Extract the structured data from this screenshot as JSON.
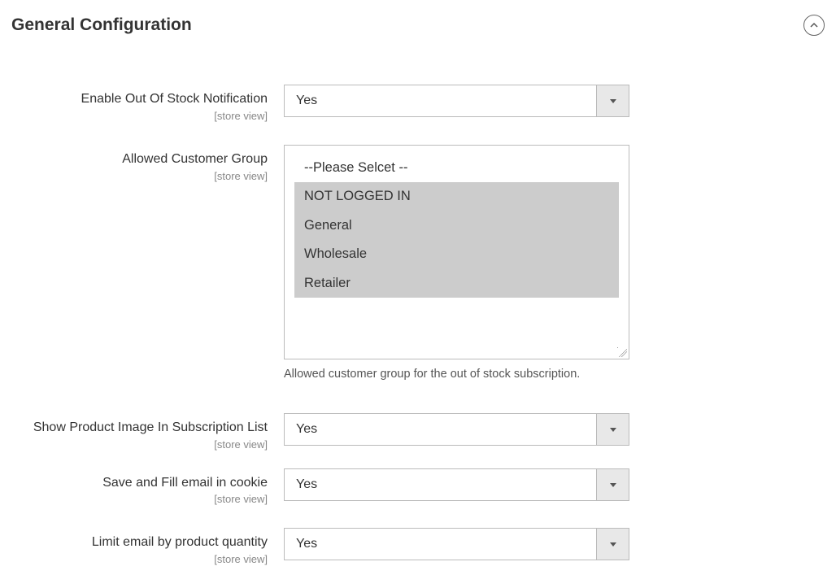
{
  "header": {
    "title": "General Configuration"
  },
  "scope_label": "[store view]",
  "fields": {
    "enable_notification": {
      "label": "Enable Out Of Stock Notification",
      "value": "Yes"
    },
    "allowed_group": {
      "label": "Allowed Customer Group",
      "options": {
        "placeholder": "--Please Selcet --",
        "opt1": "NOT LOGGED IN",
        "opt2": "General",
        "opt3": "Wholesale",
        "opt4": "Retailer"
      },
      "help": "Allowed customer group for the out of stock subscription."
    },
    "show_image": {
      "label": "Show Product Image In Subscription List",
      "value": "Yes"
    },
    "save_cookie": {
      "label": "Save and Fill email in cookie",
      "value": "Yes"
    },
    "limit_email": {
      "label": "Limit email by product quantity",
      "value": "Yes"
    }
  }
}
